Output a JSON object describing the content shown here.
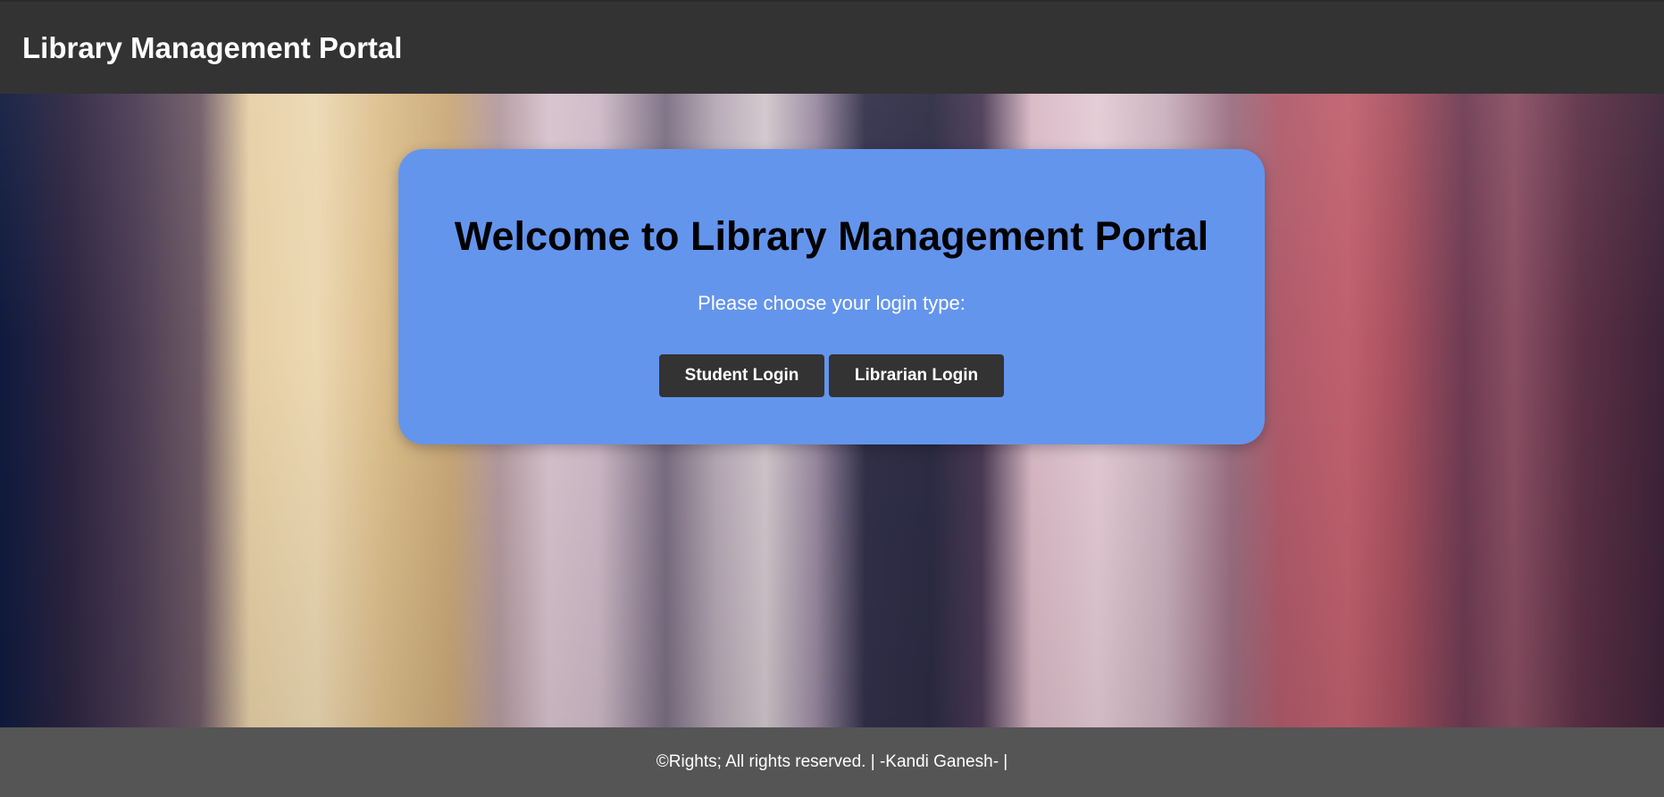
{
  "header": {
    "title": "Library Management Portal"
  },
  "card": {
    "title": "Welcome to Library Management Portal",
    "subtitle": "Please choose your login type:",
    "buttons": {
      "student_label": "Student Login",
      "librarian_label": "Librarian Login"
    }
  },
  "footer": {
    "text": "©Rights; All rights reserved. | -Kandi Ganesh- |"
  },
  "colors": {
    "header_bg": "#333333",
    "card_bg": "#6495ED",
    "button_bg": "#333333",
    "footer_bg": "#555555"
  }
}
